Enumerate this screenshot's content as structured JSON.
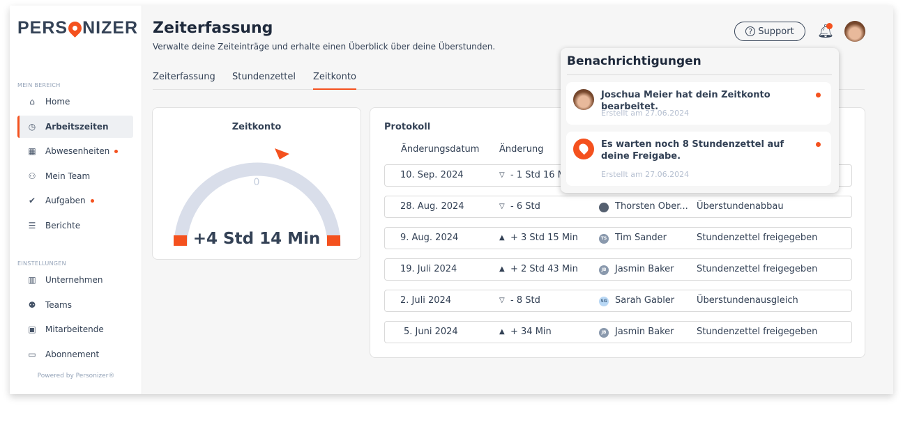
{
  "brand": {
    "logo_text": "PERSONIZER",
    "accent": "#f4511e"
  },
  "sidebar": {
    "section1": "MEIN BEREICH",
    "items1": [
      {
        "label": "Home",
        "icon": "home-icon"
      },
      {
        "label": "Arbeitszeiten",
        "icon": "clock-icon",
        "active": true
      },
      {
        "label": "Abwesenheiten",
        "icon": "calendar-icon",
        "badge": true
      },
      {
        "label": "Mein Team",
        "icon": "users-icon"
      },
      {
        "label": "Aufgaben",
        "icon": "check-icon",
        "badge": true
      },
      {
        "label": "Berichte",
        "icon": "list-icon"
      }
    ],
    "section2": "EINSTELLUNGEN",
    "items2": [
      {
        "label": "Unternehmen",
        "icon": "building-icon"
      },
      {
        "label": "Teams",
        "icon": "team-icon"
      },
      {
        "label": "Mitarbeitende",
        "icon": "id-card-icon"
      },
      {
        "label": "Abonnement",
        "icon": "credit-card-icon"
      }
    ],
    "powered": "Powered by Personizer®"
  },
  "header": {
    "title": "Zeiterfassung",
    "subtitle": "Verwalte deine Zeiteinträge und erhalte einen Überblick über deine Überstunden.",
    "support": "Support"
  },
  "tabs": [
    {
      "label": "Zeiterfassung"
    },
    {
      "label": "Stundenzettel"
    },
    {
      "label": "Zeitkonto",
      "active": true
    }
  ],
  "zeitkonto": {
    "title": "Zeitkonto",
    "zero_label": "0",
    "value": "+4 Std 14 Min"
  },
  "protokoll": {
    "title": "Protokoll",
    "col_date": "Änderungsdatum",
    "col_change": "Änderung",
    "rows": [
      {
        "date": "10. Sep. 2024",
        "change": "- 1 Std 16 Min",
        "dir": "down",
        "user": "",
        "initials": "",
        "desc": ""
      },
      {
        "date": "28. Aug. 2024",
        "change": "- 6 Std",
        "dir": "down",
        "user": "Thorsten Ober...",
        "initials": "",
        "desc": "Überstundenabbau"
      },
      {
        "date": "9. Aug. 2024",
        "change": "+ 3 Std 15 Min",
        "dir": "up",
        "user": "Tim Sander",
        "initials": "TS",
        "desc": "Stundenzettel freigegeben"
      },
      {
        "date": "19. Juli 2024",
        "change": "+ 2 Std 43 Min",
        "dir": "up",
        "user": "Jasmin Baker",
        "initials": "JB",
        "desc": "Stundenzettel freigegeben"
      },
      {
        "date": "2. Juli 2024",
        "change": "- 8 Std",
        "dir": "down",
        "user": "Sarah Gabler",
        "initials": "SG",
        "desc": "Überstundenausgleich"
      },
      {
        "date": "5. Juni 2024",
        "change": "+ 34 Min",
        "dir": "up",
        "user": "Jasmin Baker",
        "initials": "JB",
        "desc": "Stundenzettel freigegeben"
      }
    ]
  },
  "notifications": {
    "title": "Benachrichtigungen",
    "items": [
      {
        "text": "Joschua Meier hat dein Zeitkonto bearbeitet.",
        "date": "Erstellt am 27.06.2024"
      },
      {
        "text": "Es warten noch 8 Stundenzettel auf deine Freigabe.",
        "date": "Erstellt am 27.06.2024"
      }
    ]
  }
}
